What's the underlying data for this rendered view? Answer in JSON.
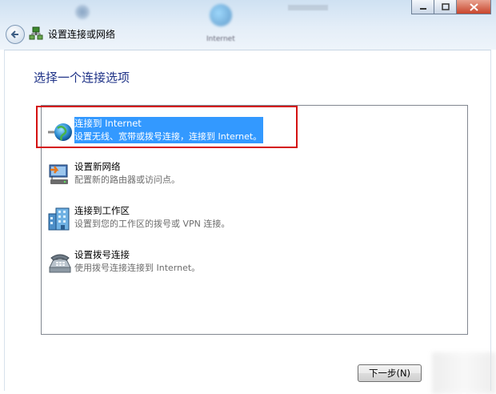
{
  "window": {
    "title": "设置连接或网络",
    "blurred_icon_label": "Internet"
  },
  "heading": "选择一个连接选项",
  "options": [
    {
      "title": "连接到 Internet",
      "description": "设置无线、宽带或拨号连接，连接到 Internet。",
      "icon": "globe-network-icon",
      "selected": true
    },
    {
      "title": "设置新网络",
      "description": "配置新的路由器或访问点。",
      "icon": "router-setup-icon",
      "selected": false
    },
    {
      "title": "连接到工作区",
      "description": "设置到您的工作区的拨号或 VPN 连接。",
      "icon": "workplace-building-icon",
      "selected": false
    },
    {
      "title": "设置拨号连接",
      "description": "使用拨号连接连接到 Internet。",
      "icon": "dialup-phone-icon",
      "selected": false
    }
  ],
  "buttons": {
    "next": "下一步(N)"
  },
  "colors": {
    "selection": "#3399ff",
    "highlight_box": "#d41111",
    "heading": "#1e3287"
  }
}
